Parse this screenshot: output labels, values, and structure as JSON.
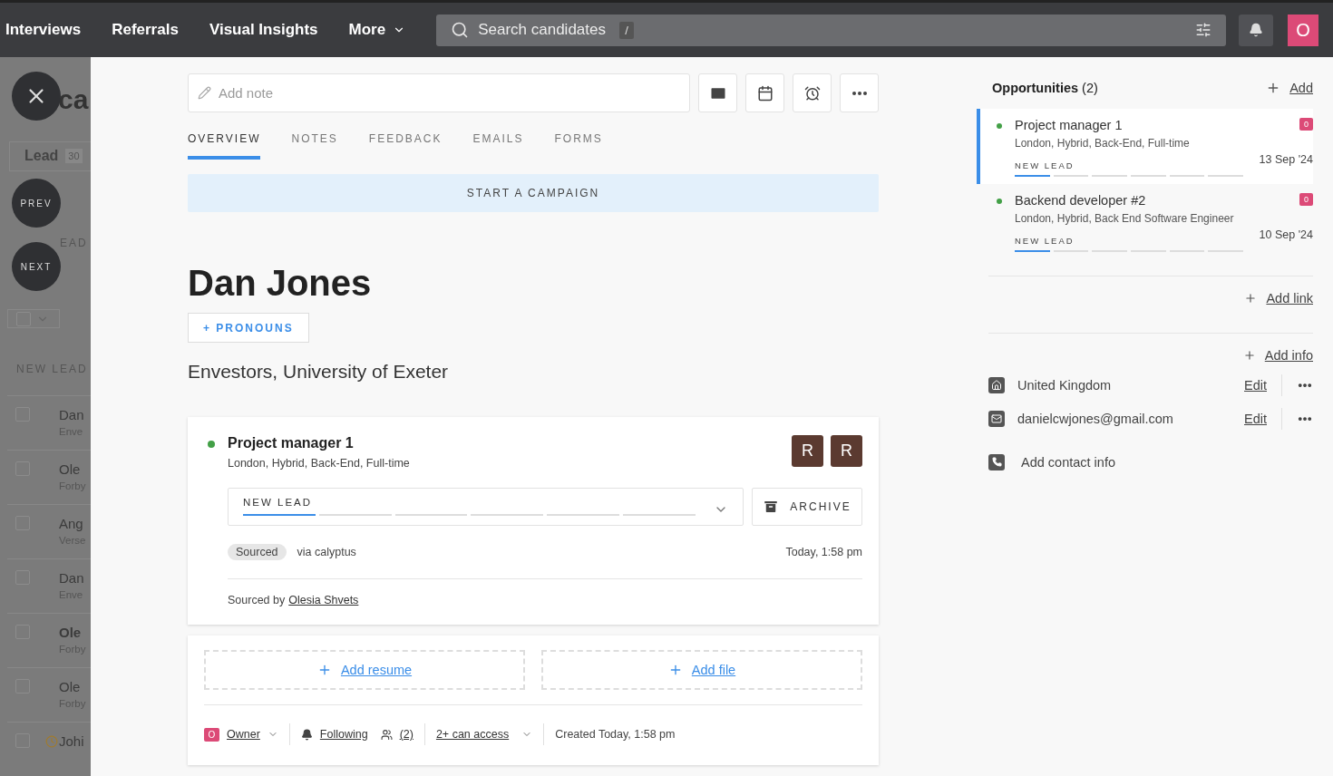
{
  "nav": {
    "items": [
      {
        "label": "Interviews",
        "dropdown": false
      },
      {
        "label": "Referrals",
        "dropdown": false
      },
      {
        "label": "Visual Insights",
        "dropdown": false
      },
      {
        "label": "More",
        "dropdown": true
      }
    ],
    "search": {
      "placeholder": "Search candidates",
      "shortcut": "/"
    },
    "avatar": "O"
  },
  "sidebar": {
    "title": "ca",
    "tab": {
      "label": "Lead",
      "count": "30"
    },
    "stage_fragment": "EAD",
    "section": "NEW LEAD",
    "rows": [
      {
        "name": "Dan",
        "detail": "Enve",
        "checked": false,
        "unread": false,
        "reminder": false
      },
      {
        "name": "Ole",
        "detail": "Forby",
        "checked": false,
        "unread": false,
        "reminder": false
      },
      {
        "name": "Ang",
        "detail": "Verse",
        "checked": false,
        "unread": false,
        "reminder": false
      },
      {
        "name": "Dan",
        "detail": "Enve",
        "checked": false,
        "unread": false,
        "reminder": false
      },
      {
        "name": "Ole",
        "detail": "Forby",
        "checked": false,
        "unread": true,
        "reminder": false
      },
      {
        "name": "Ole",
        "detail": "Forby",
        "checked": false,
        "unread": false,
        "reminder": false
      },
      {
        "name": "Johi",
        "checked": false,
        "unread": false,
        "reminder": true
      }
    ],
    "nav_buttons": [
      "PREV",
      "NEXT"
    ]
  },
  "note": {
    "placeholder": "Add note"
  },
  "tabs": [
    {
      "label": "OVERVIEW",
      "selected": true
    },
    {
      "label": "NOTES",
      "selected": false
    },
    {
      "label": "FEEDBACK",
      "selected": false
    },
    {
      "label": "EMAILS",
      "selected": false
    },
    {
      "label": "FORMS",
      "selected": false
    }
  ],
  "campaign": "START A CAMPAIGN",
  "candidate": {
    "name": "Dan Jones",
    "pronouns": "+ PRONOUNS",
    "headline": "Envestors, University of Exeter"
  },
  "opportunity": {
    "title": "Project manager 1",
    "details": "London, Hybrid, Back-End, Full-time",
    "avatars": [
      "R",
      "R"
    ],
    "stage": "NEW LEAD",
    "steps": [
      {
        "done": true
      },
      {
        "done": false
      },
      {
        "done": false
      },
      {
        "done": false
      },
      {
        "done": false
      },
      {
        "done": false
      }
    ],
    "archive": "ARCHIVE",
    "source_tag": "Sourced",
    "source": "via calyptus",
    "time": "Today, 1:58 pm",
    "sourced_by": "Sourced by",
    "sourcer": "Olesia Shvets"
  },
  "files": [
    "Add resume",
    "Add file"
  ],
  "footer": {
    "owner_badge": "O",
    "owner": "Owner",
    "following": "Following",
    "followers": "(2)",
    "access": "2+ can access",
    "created": "Created Today, 1:58 pm"
  },
  "opportunities": {
    "title": "Opportunities",
    "count": "(2)",
    "add": "Add",
    "items": [
      {
        "title": "Project manager 1",
        "details": "London, Hybrid, Back-End, Full-time",
        "stage": "NEW LEAD",
        "date": "13 Sep '24",
        "badge": "0",
        "selected": true,
        "steps": [
          {
            "done": true
          },
          {
            "done": false
          },
          {
            "done": false
          },
          {
            "done": false
          },
          {
            "done": false
          },
          {
            "done": false
          }
        ]
      },
      {
        "title": "Backend developer #2",
        "details": "London, Hybrid, Back End Software Engineer",
        "stage": "NEW LEAD",
        "date": "10 Sep '24",
        "badge": "0",
        "selected": false,
        "steps": [
          {
            "done": true
          },
          {
            "done": false
          },
          {
            "done": false
          },
          {
            "done": false
          },
          {
            "done": false
          },
          {
            "done": false
          }
        ]
      }
    ]
  },
  "add_link": "Add link",
  "add_info": "Add info",
  "contacts": [
    {
      "kind": "location",
      "value": "United Kingdom",
      "action": "Edit"
    },
    {
      "kind": "email",
      "value": "danielcwjones@gmail.com",
      "action": "Edit"
    }
  ],
  "add_contact": "Add contact info"
}
